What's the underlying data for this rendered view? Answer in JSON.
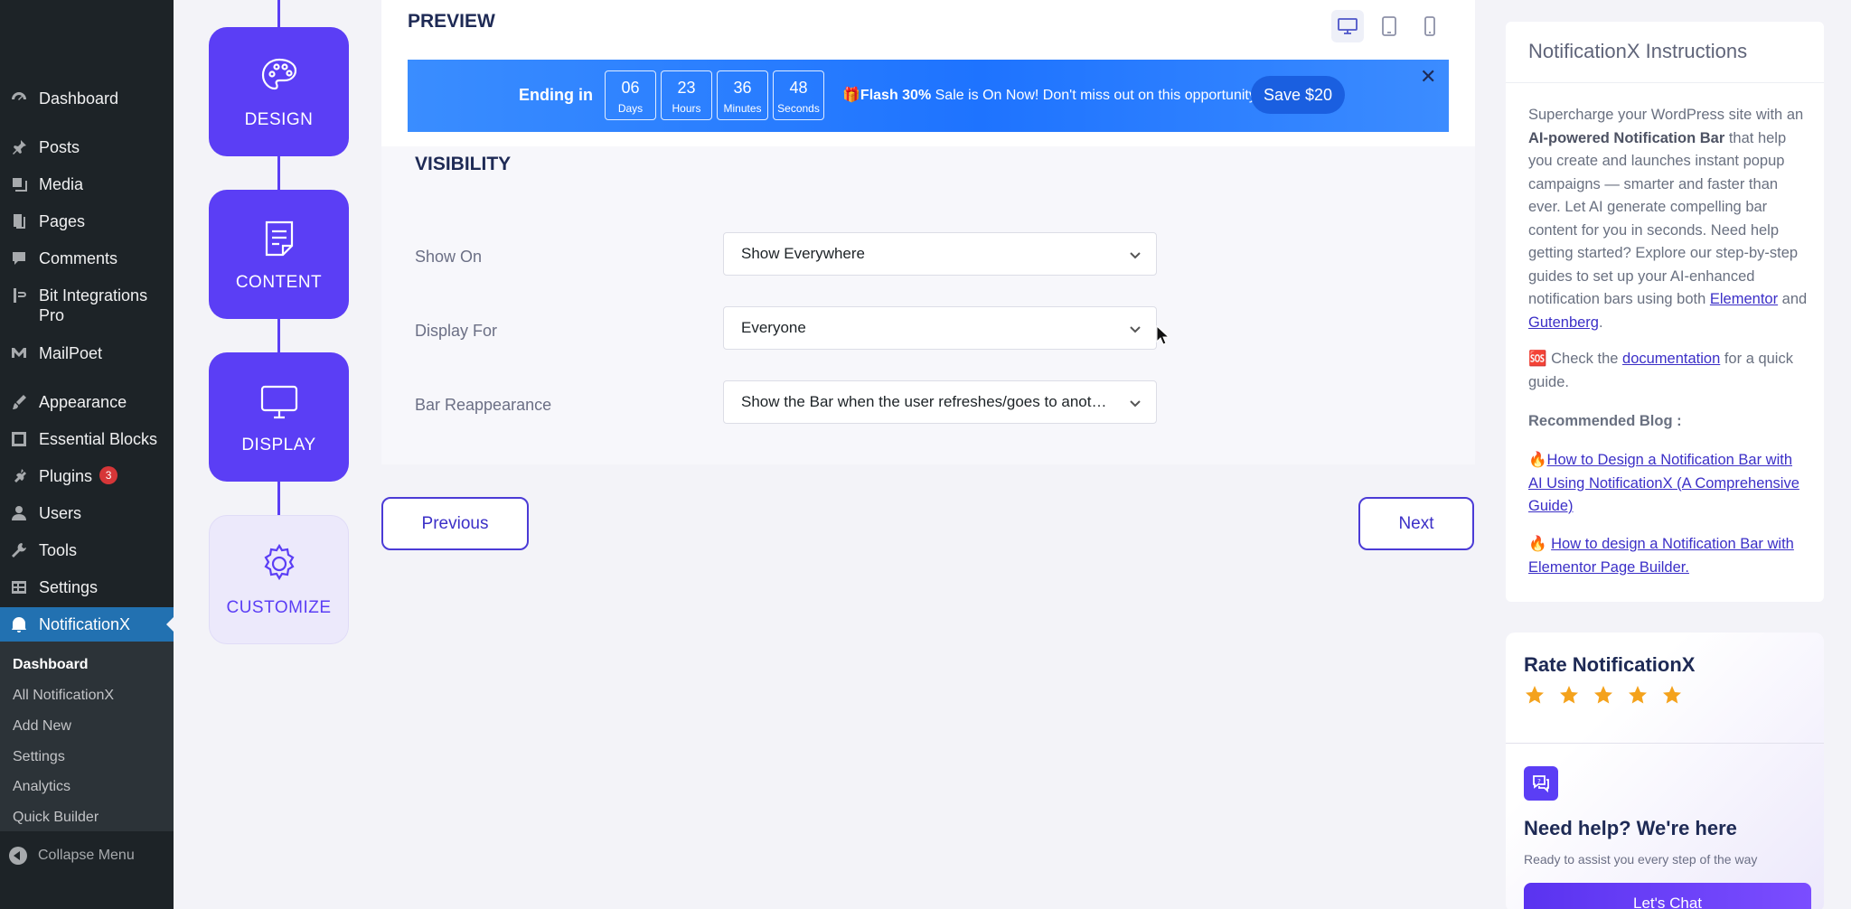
{
  "wp_menu": {
    "items": [
      {
        "label": "Dashboard",
        "icon": "dashboard-icon"
      },
      {
        "label": "Posts",
        "icon": "pin-icon"
      },
      {
        "label": "Media",
        "icon": "media-icon"
      },
      {
        "label": "Pages",
        "icon": "pages-icon"
      },
      {
        "label": "Comments",
        "icon": "comment-icon"
      },
      {
        "label": "Bit Integrations Pro",
        "icon": "bit-icon"
      },
      {
        "label": "MailPoet",
        "icon": "mailpoet-icon"
      },
      {
        "label": "Appearance",
        "icon": "brush-icon"
      },
      {
        "label": "Essential Blocks",
        "icon": "blocks-icon"
      },
      {
        "label": "Plugins",
        "icon": "plugin-icon",
        "badge": "3"
      },
      {
        "label": "Users",
        "icon": "user-icon"
      },
      {
        "label": "Tools",
        "icon": "wrench-icon"
      },
      {
        "label": "Settings",
        "icon": "settings-icon"
      },
      {
        "label": "NotificationX",
        "icon": "notificationx-icon"
      }
    ],
    "submenu": [
      "Dashboard",
      "All NotificationX",
      "Add New",
      "Settings",
      "Analytics",
      "Quick Builder"
    ],
    "collapse_label": "Collapse Menu"
  },
  "steps": [
    {
      "label": "DESIGN",
      "icon": "palette-icon"
    },
    {
      "label": "CONTENT",
      "icon": "document-icon"
    },
    {
      "label": "DISPLAY",
      "icon": "monitor-icon"
    },
    {
      "label": "CUSTOMIZE",
      "icon": "gear-icon"
    }
  ],
  "preview": {
    "title": "PREVIEW",
    "bar": {
      "ending_label": "Ending in",
      "countdown": [
        {
          "value": "06",
          "unit": "Days"
        },
        {
          "value": "23",
          "unit": "Hours"
        },
        {
          "value": "36",
          "unit": "Minutes"
        },
        {
          "value": "48",
          "unit": "Seconds"
        }
      ],
      "msg_emoji": "🎁",
      "msg_bold": "Flash 30%",
      "msg_rest": " Sale is On Now! Don't miss out on this opportunity",
      "button": "Save $20",
      "close": "✕"
    }
  },
  "visibility": {
    "title": "VISIBILITY",
    "fields": [
      {
        "label": "Show On",
        "value": "Show Everywhere"
      },
      {
        "label": "Display For",
        "value": "Everyone"
      },
      {
        "label": "Bar Reappearance",
        "value": "Show the Bar when the user refreshes/goes to another page"
      }
    ]
  },
  "nav": {
    "previous": "Previous",
    "next": "Next"
  },
  "instructions": {
    "title": "NotificationX Instructions",
    "p1_a": "Supercharge your WordPress site with an ",
    "p1_bold": "AI-powered Notification Bar",
    "p1_b": " that help you create and launches instant popup campaigns — smarter and faster than ever. Let AI generate compelling bar content for you in seconds. Need help getting started? Explore our step-by-step guides to set up your AI-enhanced notification bars using both ",
    "link_elementor": "Elementor",
    "and": " and ",
    "link_gutenberg": "Gutenberg",
    "dot": ".",
    "p2_icon": "🆘",
    "p2_a": " Check the ",
    "link_doc": "documentation",
    "p2_b": " for a quick guide.",
    "blog_title": "Recommended Blog :",
    "blog1_emoji": "🔥",
    "blog1": "How to Design a Notification Bar with AI Using NotificationX (A Comprehensive Guide)",
    "blog2_emoji": "🔥 ",
    "blog2": "How to design a Notification Bar with Elementor Page Builder."
  },
  "rate": {
    "title": "Rate NotificationX",
    "stars": 5
  },
  "help": {
    "title": "Need help? We're here",
    "subtitle": "Ready to assist you every step of the way",
    "button": "Let's Chat"
  }
}
